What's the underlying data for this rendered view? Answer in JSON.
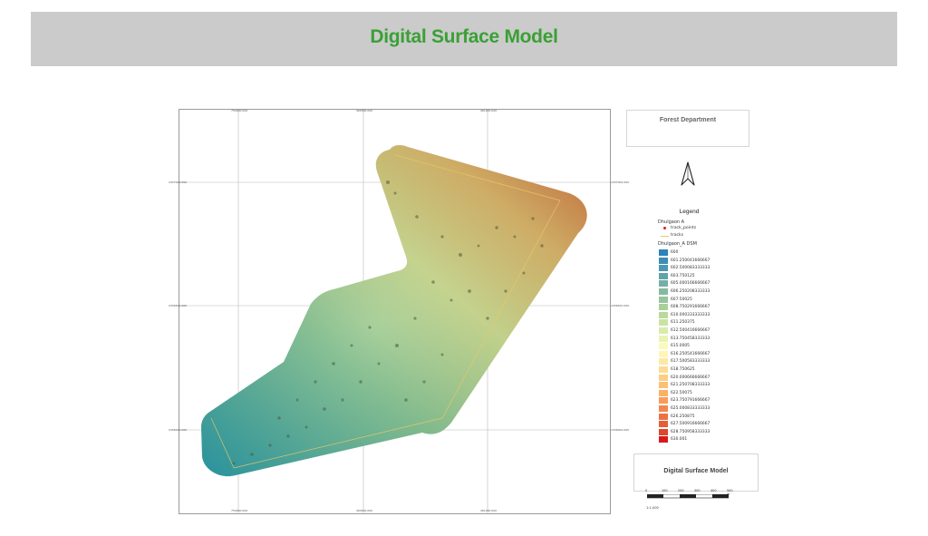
{
  "header": {
    "title": "Digital Surface Model"
  },
  "map": {
    "top_ticks": [
      "750000.000",
      "460500.000",
      "461000.000"
    ],
    "bottom_ticks": [
      "750000.000",
      "460500.000",
      "461000.000"
    ],
    "left_ticks": [
      "2457000.000",
      "2456500.000",
      "2456000.000"
    ],
    "right_ticks": [
      "2457000.000",
      "2456500.000",
      "2456000.000"
    ],
    "colors": {
      "low": "#2b83ba",
      "mid": "#ffffbf",
      "high": "#d7191c"
    }
  },
  "organization": {
    "name": "Forest Department"
  },
  "north_arrow": {
    "icon": "north-arrow-icon"
  },
  "legend": {
    "title": "Legend",
    "group": "Dhulgaon A",
    "layers": [
      {
        "label": "track_points",
        "icon": "red-dot-icon"
      },
      {
        "label": "tracks",
        "icon": "yellow-line-icon"
      }
    ],
    "dsm_title": "Dhulgaon_A DSM",
    "classes": [
      {
        "label": "600",
        "color": "#2b83ba"
      },
      {
        "label": "601.250041666667",
        "color": "#3b8db5"
      },
      {
        "label": "602.500083333333",
        "color": "#4d98b0"
      },
      {
        "label": "603.750125",
        "color": "#60a3ab"
      },
      {
        "label": "605.000166666667",
        "color": "#73aea7"
      },
      {
        "label": "606.250208333333",
        "color": "#86b9a2"
      },
      {
        "label": "607.50025",
        "color": "#97c49d"
      },
      {
        "label": "608.750291666667",
        "color": "#a9cf99"
      },
      {
        "label": "610.000333333333",
        "color": "#bad99b"
      },
      {
        "label": "611.250375",
        "color": "#cae3a3"
      },
      {
        "label": "612.500416666667",
        "color": "#d9ebab"
      },
      {
        "label": "613.750458333333",
        "color": "#e9f4b4"
      },
      {
        "label": "615.0005",
        "color": "#f8fbbc"
      },
      {
        "label": "616.250541666667",
        "color": "#fff5b5"
      },
      {
        "label": "617.500583333333",
        "color": "#fee8a5"
      },
      {
        "label": "618.750625",
        "color": "#fedb95"
      },
      {
        "label": "620.000666666667",
        "color": "#fdcd85"
      },
      {
        "label": "621.250708333333",
        "color": "#fdbf75"
      },
      {
        "label": "622.50075",
        "color": "#fcb065"
      },
      {
        "label": "623.750791666667",
        "color": "#f89c5b"
      },
      {
        "label": "625.000833333333",
        "color": "#f2884f"
      },
      {
        "label": "626.250875",
        "color": "#eb7343"
      },
      {
        "label": "627.500916666667",
        "color": "#e45e38"
      },
      {
        "label": "628.750958333333",
        "color": "#dd482c"
      },
      {
        "label": "630.001",
        "color": "#d7191c"
      }
    ]
  },
  "title_box": {
    "text": "Digital Surface Model"
  },
  "scale": {
    "ticks": [
      "0",
      "100",
      "200",
      "300",
      "400",
      "500 m"
    ],
    "ratio": "1:1,000"
  }
}
